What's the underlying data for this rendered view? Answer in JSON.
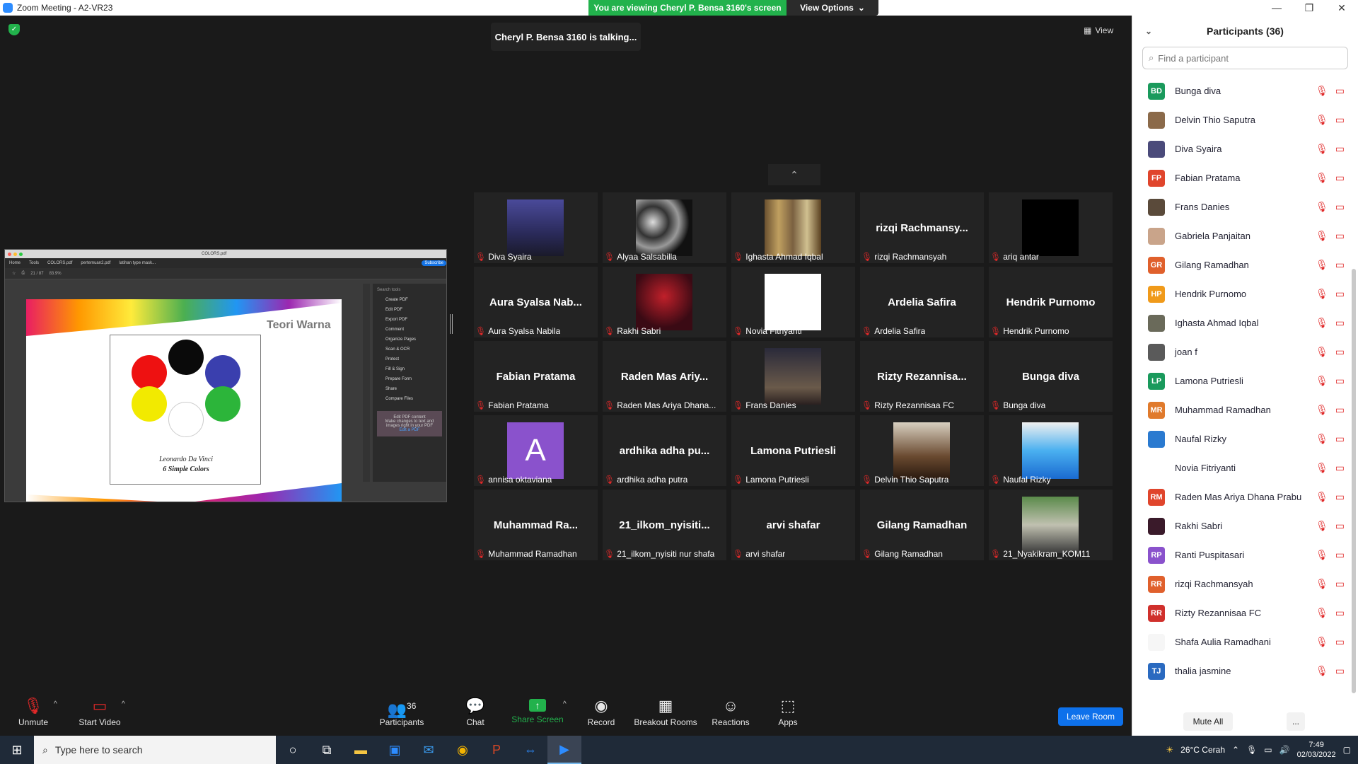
{
  "window": {
    "title": "Zoom Meeting - A2-VR23",
    "controls": [
      "—",
      "❐",
      "✕"
    ]
  },
  "banner": {
    "viewing": "You are viewing Cheryl P. Bensa 3160's screen",
    "view_options": "View Options"
  },
  "talking": "Cheryl P. Bensa 3160 is talking...",
  "view_label": "View",
  "shared_screen": {
    "file_title": "COLORS.pdf",
    "tabs": [
      "Home",
      "Tools",
      "COLORS.pdf",
      "pertemuan2.pdf",
      "latihan type mask..."
    ],
    "subscribe": "Subscribe",
    "page_indicator": "21 / 87",
    "zoom": "83.9%",
    "slide_title": "Teori Warna",
    "caption_line1": "Leonardo Da Vinci",
    "caption_line2": "6 Simple Colors",
    "tools_search": "Search tools",
    "tools": [
      "Create PDF",
      "Edit PDF",
      "Export PDF",
      "Comment",
      "Organize Pages",
      "Scan & OCR",
      "Protect",
      "Fill & Sign",
      "Prepare Form",
      "Share",
      "Compare Files"
    ],
    "edit_pdf_title": "Edit PDF content",
    "edit_pdf_desc": "Make changes to text and images right in your PDF",
    "edit_pdf_link": "Edit a PDF",
    "colors": {
      "black": "#0a0a0a",
      "red": "#ee1111",
      "blue": "#3a3fae",
      "yellow": "#f2ea00",
      "green": "#2cb53a",
      "white": "#ffffff"
    }
  },
  "gallery": [
    {
      "display": "",
      "label": "Diva Syaira",
      "image": "photo-night-sky"
    },
    {
      "display": "",
      "label": "Alyaa Salsabilla",
      "image": "photo-marble"
    },
    {
      "display": "",
      "label": "Ighasta Ahmad Iqbal",
      "image": "photo-forest"
    },
    {
      "display": "rizqi  Rachmansy...",
      "label": "rizqi Rachmansyah",
      "image": ""
    },
    {
      "display": "",
      "label": "ariq antar",
      "image": "photo-black"
    },
    {
      "display": "Aura Syalsa Nab...",
      "label": "Aura Syalsa Nabila",
      "image": ""
    },
    {
      "display": "",
      "label": "Rakhi Sabri",
      "image": "photo-red-hair"
    },
    {
      "display": "",
      "label": "Novia Fitriyanti",
      "image": "photo-white"
    },
    {
      "display": "Ardelia Safira",
      "label": "Ardelia Safira",
      "image": ""
    },
    {
      "display": "Hendrik Purnomo",
      "label": "Hendrik Purnomo",
      "image": ""
    },
    {
      "display": "Fabian Pratama",
      "label": "Fabian Pratama",
      "image": ""
    },
    {
      "display": "Raden  Mas  Ariy...",
      "label": "Raden Mas Ariya Dhana...",
      "image": ""
    },
    {
      "display": "",
      "label": "Frans Danies",
      "image": "photo-city-night"
    },
    {
      "display": "Rizty  Rezannisa...",
      "label": "Rizty Rezannisaa FC",
      "image": ""
    },
    {
      "display": "Bunga diva",
      "label": "Bunga diva",
      "image": ""
    },
    {
      "display": "",
      "label": "annisa oktaviana",
      "image": "avatar-A",
      "avatar_letter": "A"
    },
    {
      "display": "ardhika  adha  pu...",
      "label": "ardhika adha putra",
      "image": ""
    },
    {
      "display": "Lamona Putriesli",
      "label": "Lamona Putriesli",
      "image": ""
    },
    {
      "display": "",
      "label": "Delvin Thio Saputra",
      "image": "photo-room"
    },
    {
      "display": "",
      "label": "Naufal Rizky",
      "image": "photo-blue-cap"
    },
    {
      "display": "Muhammad  Ra...",
      "label": "Muhammad Ramadhan",
      "image": ""
    },
    {
      "display": "21_ilkom_nyisiti...",
      "label": "21_ilkom_nyisiti nur shafa",
      "image": ""
    },
    {
      "display": "arvi shafar",
      "label": "arvi shafar",
      "image": ""
    },
    {
      "display": "Gilang Ramadhan",
      "label": "Gilang Ramadhan",
      "image": ""
    },
    {
      "display": "",
      "label": "21_Nyakikram_KOM11",
      "image": "photo-outdoor"
    }
  ],
  "toolbar": {
    "unmute": "Unmute",
    "start_video": "Start Video",
    "participants": "Participants",
    "participants_count": "36",
    "chat": "Chat",
    "share_screen": "Share Screen",
    "record": "Record",
    "breakout_rooms": "Breakout Rooms",
    "reactions": "Reactions",
    "apps": "Apps",
    "leave": "Leave Room"
  },
  "panel": {
    "title": "Participants (36)",
    "search_placeholder": "Find a participant",
    "mute_all": "Mute All",
    "more": "...",
    "participants": [
      {
        "initials": "BD",
        "name": "Bunga diva",
        "color": "#1a9a5c"
      },
      {
        "initials": "",
        "name": "Delvin Thio Saputra",
        "color": "#8b6a4a"
      },
      {
        "initials": "",
        "name": "Diva Syaira",
        "color": "#4a4a7a"
      },
      {
        "initials": "FP",
        "name": "Fabian Pratama",
        "color": "#e0452c"
      },
      {
        "initials": "",
        "name": "Frans Danies",
        "color": "#5a4a3a"
      },
      {
        "initials": "",
        "name": "Gabriela Panjaitan",
        "color": "#c9a48a"
      },
      {
        "initials": "GR",
        "name": "Gilang Ramadhan",
        "color": "#e0602c"
      },
      {
        "initials": "HP",
        "name": "Hendrik Purnomo",
        "color": "#f09a1a"
      },
      {
        "initials": "",
        "name": "Ighasta Ahmad Iqbal",
        "color": "#6a6a5a"
      },
      {
        "initials": "",
        "name": "joan f",
        "color": "#5a5a5a"
      },
      {
        "initials": "LP",
        "name": "Lamona Putriesli",
        "color": "#1a9a5c"
      },
      {
        "initials": "MR",
        "name": "Muhammad Ramadhan",
        "color": "#e07a2c"
      },
      {
        "initials": "",
        "name": "Naufal Rizky",
        "color": "#2a7ad0"
      },
      {
        "initials": "",
        "name": "Novia Fitriyanti",
        "color": "#ffffff"
      },
      {
        "initials": "RM",
        "name": "Raden Mas Ariya Dhana Prabu",
        "color": "#e0452c"
      },
      {
        "initials": "",
        "name": "Rakhi Sabri",
        "color": "#3a1a2a"
      },
      {
        "initials": "RP",
        "name": "Ranti Puspitasari",
        "color": "#8a52cc"
      },
      {
        "initials": "RR",
        "name": "rizqi Rachmansyah",
        "color": "#e0602c"
      },
      {
        "initials": "RR",
        "name": "Rizty Rezannisaa FC",
        "color": "#d0302c"
      },
      {
        "initials": "",
        "name": "Shafa Aulia Ramadhani",
        "color": "#f6f6f6"
      },
      {
        "initials": "TJ",
        "name": "thalia jasmine",
        "color": "#2a6ac0"
      }
    ]
  },
  "taskbar": {
    "search_placeholder": "Type here to search",
    "weather": "26°C  Cerah",
    "time": "7:49",
    "date": "02/03/2022"
  }
}
